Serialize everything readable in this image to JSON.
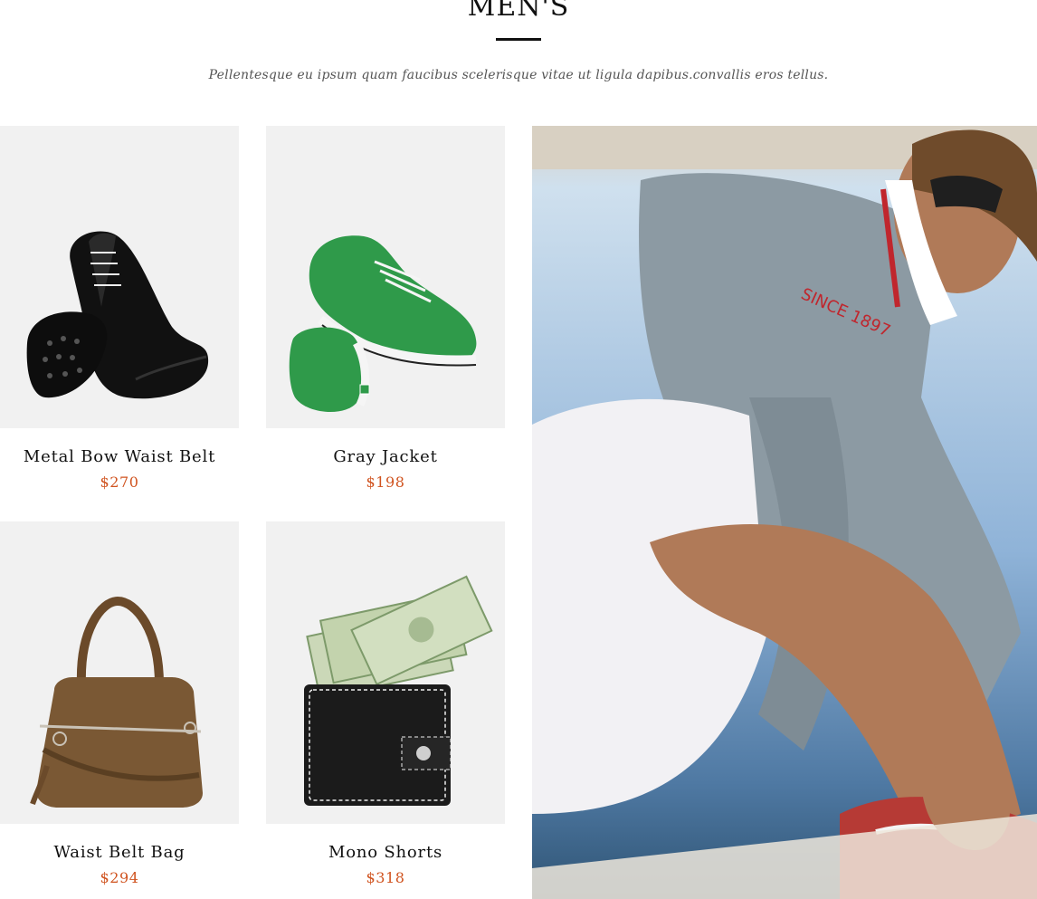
{
  "section": {
    "title": "MEN'S",
    "subtitle": "Pellentesque eu ipsum quam faucibus scelerisque vitae ut ligula dapibus.convallis eros tellus."
  },
  "products": [
    {
      "name": "Metal Bow Waist Belt",
      "price": "$270",
      "image": "black-leather-shoes"
    },
    {
      "name": "Gray Jacket",
      "price": "$198",
      "image": "green-sneakers"
    },
    {
      "name": "Waist Belt Bag",
      "price": "$294",
      "image": "brown-handbag"
    },
    {
      "name": "Mono Shorts",
      "price": "$318",
      "image": "wallet-with-cash"
    }
  ],
  "feature": {
    "image": "man-tying-red-shoes-on-boat",
    "sleeve_print": "SINCE 1897"
  },
  "colors": {
    "price": "#d0531f",
    "card_bg": "#f1f1f1",
    "title": "#111111"
  }
}
